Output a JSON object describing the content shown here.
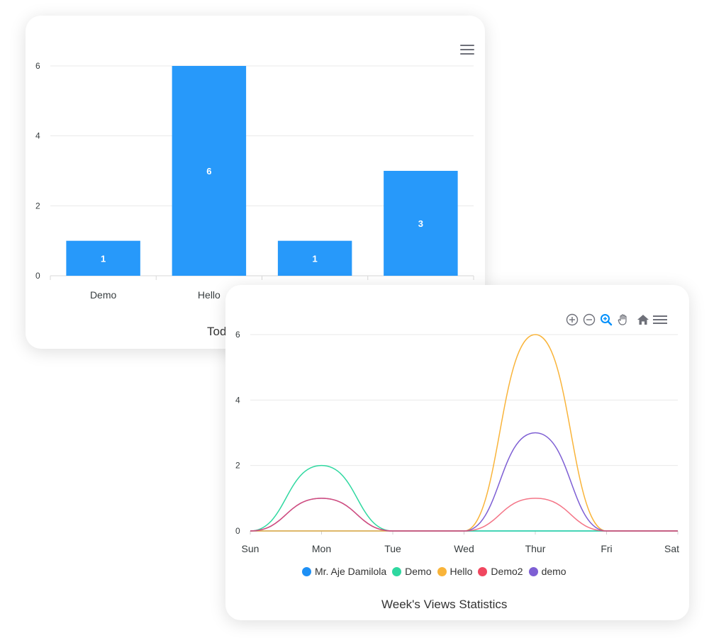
{
  "chart_data": [
    {
      "type": "bar",
      "title": "Tod",
      "categories": [
        "Demo",
        "Hello",
        "",
        ""
      ],
      "values": [
        1,
        6,
        1,
        3
      ],
      "ylim": [
        0,
        6
      ],
      "yticks": [
        0,
        2,
        4,
        6
      ],
      "grid": true,
      "color": "#2799fa"
    },
    {
      "type": "line",
      "title": "Week's Views Statistics",
      "categories": [
        "Sun",
        "Mon",
        "Tue",
        "Wed",
        "Thur",
        "Fri",
        "Sat"
      ],
      "ylim": [
        0,
        6
      ],
      "yticks": [
        0,
        2,
        4,
        6
      ],
      "grid": true,
      "legend_position": "bottom",
      "series": [
        {
          "name": "Mr. Aje Damilola",
          "color": "#1e90f5",
          "values": [
            0,
            0,
            0,
            0,
            0,
            0,
            0
          ]
        },
        {
          "name": "Demo",
          "color": "#2fd8a0",
          "values": [
            0,
            2,
            0,
            0,
            0,
            0,
            0
          ]
        },
        {
          "name": "Hello",
          "color": "#f9b43a",
          "values": [
            0,
            0,
            0,
            0,
            6,
            0,
            0
          ]
        },
        {
          "name": "Demo2",
          "color": "#f0475f",
          "values": [
            0,
            1,
            0,
            0,
            1,
            0,
            0
          ]
        },
        {
          "name": "demo",
          "color": "#7e5fd4",
          "values": [
            0,
            1,
            0,
            0,
            3,
            0,
            0
          ]
        }
      ]
    }
  ],
  "toolbar_icons": [
    "zoom-in-icon",
    "zoom-out-icon",
    "selection-zoom-icon",
    "pan-hand-icon",
    "home-reset-icon",
    "menu-icon"
  ]
}
